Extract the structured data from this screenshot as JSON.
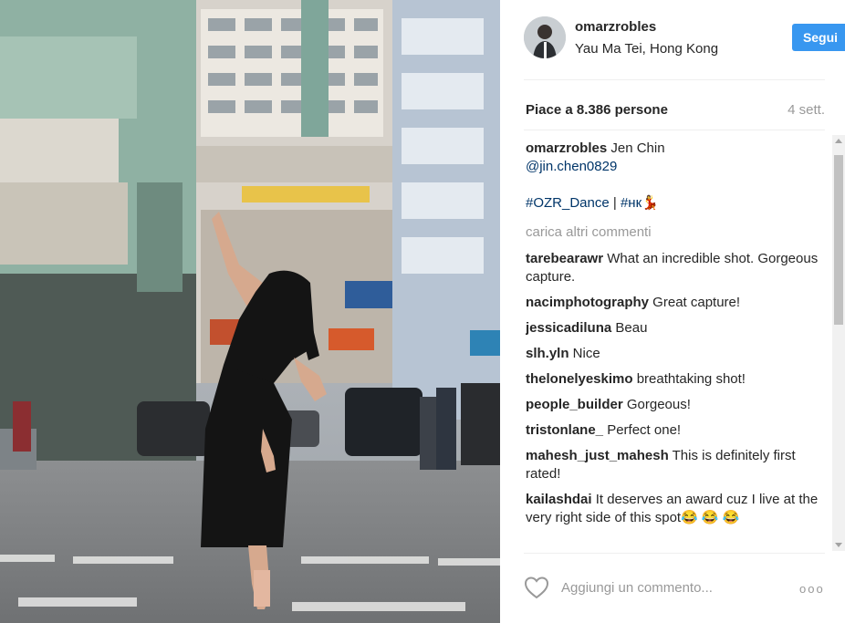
{
  "post": {
    "username": "omarzrobles",
    "location": "Yau Ma Tei, Hong Kong",
    "follow_label": "Segui",
    "likes_text": "Piace a 8.386 persone",
    "time_ago": "4 sett."
  },
  "caption": {
    "user": "omarzrobles",
    "text": " Jen Chin",
    "mention": "@jin.chen0829",
    "hashtag1": "#OZR_Dance",
    "separator": " | ",
    "hashtag2": "#нк",
    "emoji": "💃"
  },
  "load_more": "carica altri commenti",
  "comments": [
    {
      "user": "tarebearawr",
      "text": " What an incredible shot. Gorgeous capture."
    },
    {
      "user": "nacimphotography",
      "text": " Great capture!"
    },
    {
      "user": "jessicadiluna",
      "text": " Beau"
    },
    {
      "user": "slh.yln",
      "text": " Nice"
    },
    {
      "user": "thelonelyeskimo",
      "text": " breathtaking shot!"
    },
    {
      "user": "people_builder",
      "text": " Gorgeous!"
    },
    {
      "user": "tristonlane_",
      "text": " Perfect one!"
    },
    {
      "user": "mahesh_just_mahesh",
      "text": " This is definitely first rated!"
    },
    {
      "user": "kailashdai",
      "text": " It deserves an award cuz I live at the very right side of this spot😂 😂 😂"
    }
  ],
  "footer": {
    "add_comment_placeholder": "Aggiungi un commento...",
    "more_options": "ooo"
  },
  "colors": {
    "follow_button": "#3897f0",
    "link": "#003569",
    "muted": "#999999"
  },
  "icons": [
    "heart-icon",
    "more-options-icon",
    "scroll-up-icon",
    "scroll-down-icon"
  ]
}
